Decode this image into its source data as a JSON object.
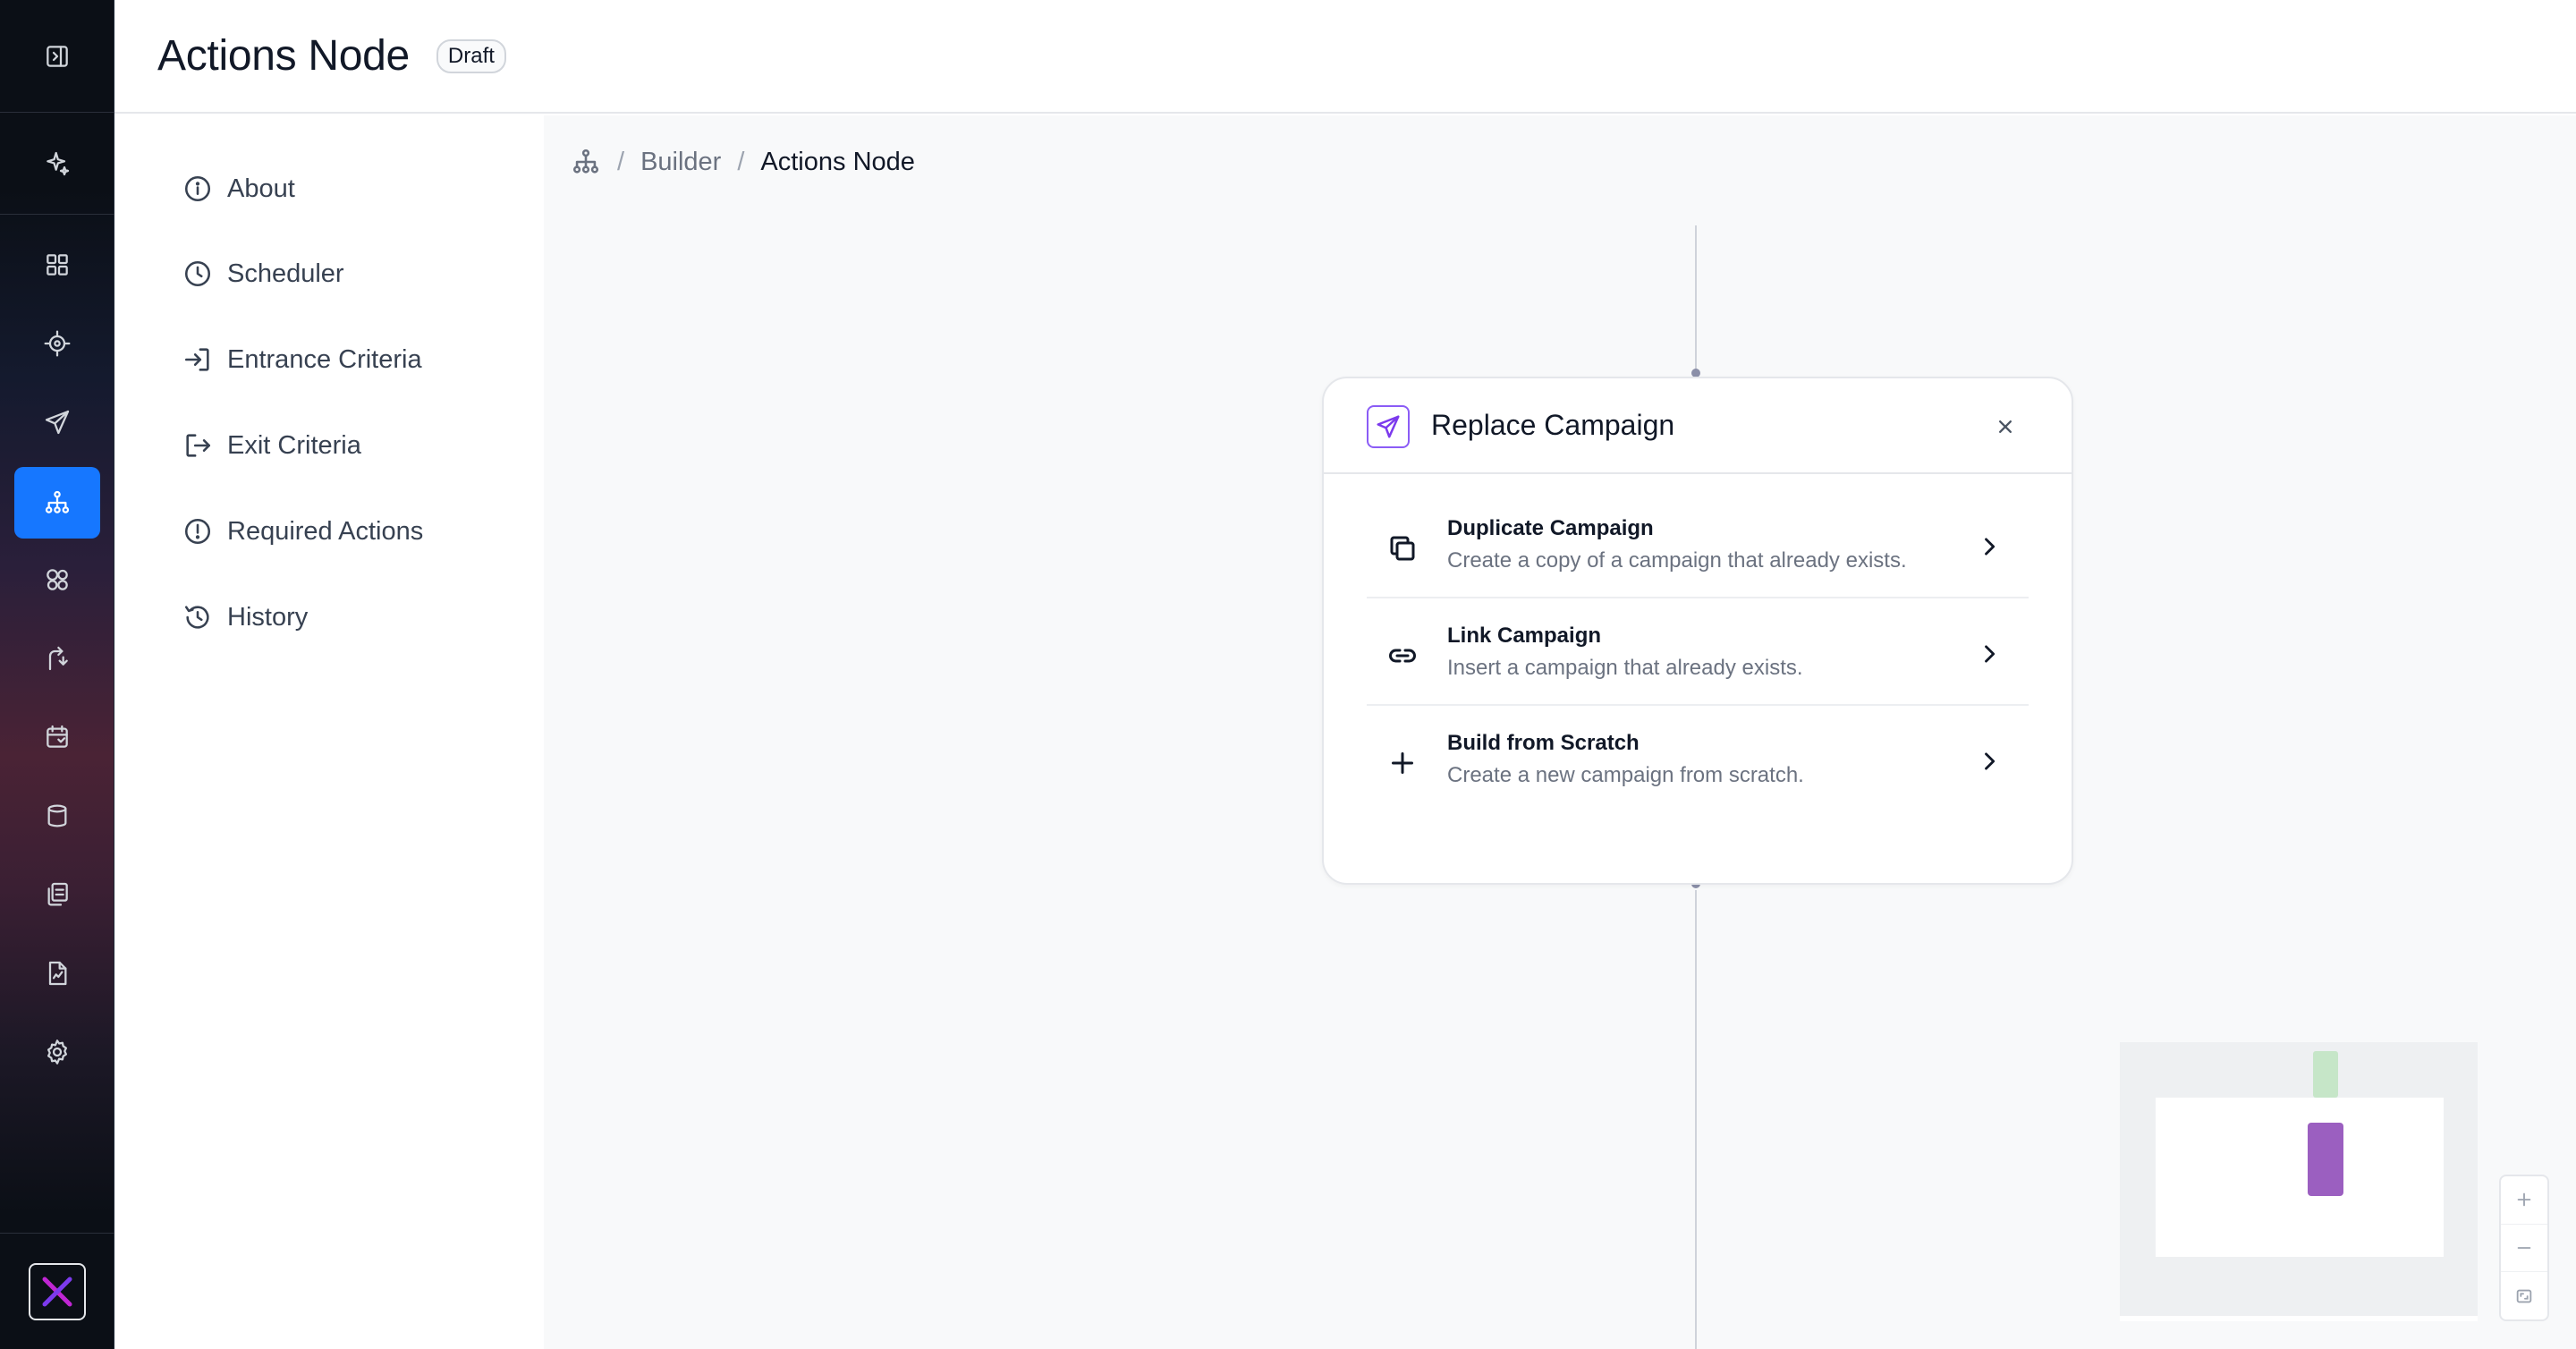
{
  "header": {
    "title": "Actions Node",
    "status_badge": "Draft"
  },
  "rail": {
    "top_icon": "sidebar-toggle-icon",
    "ai_icon": "sparkles-icon",
    "items": [
      {
        "icon": "dashboard-icon"
      },
      {
        "icon": "target-icon"
      },
      {
        "icon": "send-icon"
      },
      {
        "icon": "flow-builder-icon",
        "active": true
      },
      {
        "icon": "segments-icon"
      },
      {
        "icon": "journey-icon"
      },
      {
        "icon": "calendar-icon"
      },
      {
        "icon": "database-icon"
      },
      {
        "icon": "templates-icon"
      },
      {
        "icon": "reports-icon"
      },
      {
        "icon": "settings-icon"
      }
    ],
    "logo": "brand-logo"
  },
  "subnav": {
    "items": [
      {
        "label": "About",
        "icon": "info-icon"
      },
      {
        "label": "Scheduler",
        "icon": "clock-icon"
      },
      {
        "label": "Entrance Criteria",
        "icon": "enter-icon"
      },
      {
        "label": "Exit Criteria",
        "icon": "exit-icon"
      },
      {
        "label": "Required Actions",
        "icon": "alert-circle-icon"
      },
      {
        "label": "History",
        "icon": "history-icon"
      }
    ]
  },
  "breadcrumb": {
    "separator": "/",
    "items": [
      "Builder",
      "Actions Node"
    ]
  },
  "card": {
    "title": "Replace Campaign",
    "options": [
      {
        "title": "Duplicate Campaign",
        "description": "Create a copy of a campaign that already exists.",
        "icon": "copy-icon"
      },
      {
        "title": "Link Campaign",
        "description": "Insert a campaign that already exists.",
        "icon": "link-icon"
      },
      {
        "title": "Build from Scratch",
        "description": "Create a new campaign from scratch.",
        "icon": "plus-icon"
      }
    ]
  },
  "colors": {
    "accent": "#1677ff",
    "campaign_accent": "#7c3aed",
    "minimap_node_green": "#c6e6c8",
    "minimap_node_purple": "#9b5fc0"
  }
}
